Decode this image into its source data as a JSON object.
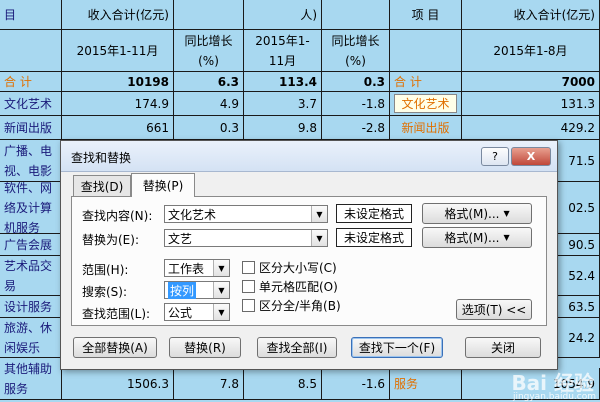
{
  "sheet": {
    "top_row": [
      "收入合计(亿元)",
      "人)",
      "项  目",
      "收入合计(亿元)"
    ],
    "headers": [
      "2015年1-11月",
      "同比增长(%)",
      "2015年1-11月",
      "同比增长(%)",
      "2015年1-8月"
    ],
    "rows": [
      {
        "label": "合  计",
        "v1": "10198",
        "v2": "6.3",
        "v3": "113.4",
        "v4": "0.3",
        "right_label": "合  计",
        "right_val": "7000"
      },
      {
        "label": "文化艺术",
        "v1": "174.9",
        "v2": "4.9",
        "v3": "3.7",
        "v4": "-1.8",
        "right_label": "文化艺术",
        "right_val": "131.3"
      },
      {
        "label": "新闻出版",
        "v1": "661",
        "v2": "0.3",
        "v3": "9.8",
        "v4": "-2.8",
        "right_label": "新闻出版",
        "right_val": "429.2"
      },
      {
        "label": "广播、电视、电影",
        "right_val": "71.5"
      },
      {
        "label": "软件、网络及计算机服务",
        "right_val": "02.5"
      },
      {
        "label": "广告会展",
        "right_val": "90.5"
      },
      {
        "label": "艺术品交易",
        "right_val": "52.4"
      },
      {
        "label": "设计服务",
        "right_val": "63.5"
      },
      {
        "label": "旅游、休闲娱乐",
        "right_val": "24.2"
      },
      {
        "label": "其他辅助服务",
        "v1": "1506.3",
        "v2": "7.8",
        "v3": "8.5",
        "v4": "-1.6",
        "right_label": "服务",
        "right_val": "1054.9"
      }
    ]
  },
  "dialog": {
    "title": "查找和替换",
    "help_btn": "?",
    "close_btn": "X",
    "tabs": [
      {
        "label": "查找(D)"
      },
      {
        "label": "替换(P)"
      }
    ],
    "find_label": "查找内容(N):",
    "find_value": "文化艺术",
    "replace_label": "替换为(E):",
    "replace_value": "文艺",
    "no_format": "未设定格式",
    "format_btn": "格式(M)...",
    "scope_label": "范围(H):",
    "scope_value": "工作表",
    "search_label": "搜索(S):",
    "search_value": "按列",
    "lookin_label": "查找范围(L):",
    "lookin_value": "公式",
    "opt_case": "区分大小写(C)",
    "opt_cell": "单元格匹配(O)",
    "opt_width": "区分全/半角(B)",
    "options_btn": "选项(T) <<",
    "replace_all_btn": "全部替换(A)",
    "replace_btn": "替换(R)",
    "find_all_btn": "查找全部(I)",
    "find_next_btn": "查找下一个(F)",
    "close_text_btn": "关闭"
  },
  "watermark": {
    "brand": "Bai 经验",
    "url": "jingyan.baidu.com"
  }
}
